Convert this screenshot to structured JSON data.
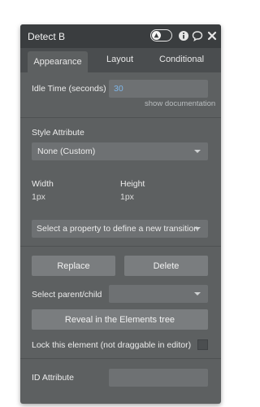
{
  "window": {
    "title": "Detect B",
    "icons": [
      "toggle-icon",
      "info-icon",
      "comment-icon",
      "close-icon"
    ]
  },
  "tabs": [
    {
      "label": "Appearance",
      "active": true
    },
    {
      "label": "Layout",
      "active": false
    },
    {
      "label": "Conditional",
      "active": false
    }
  ],
  "idle_time": {
    "label": "Idle Time (seconds)",
    "value": "30",
    "help_link": "show documentation"
  },
  "style_attribute": {
    "label": "Style Attribute",
    "value": "None (Custom)"
  },
  "dimensions": {
    "width_label": "Width",
    "width_value": "1px",
    "height_label": "Height",
    "height_value": "1px"
  },
  "transition": {
    "placeholder": "Select a property to define a new transition"
  },
  "actions": {
    "replace_label": "Replace",
    "delete_label": "Delete"
  },
  "parent_child": {
    "label": "Select parent/child",
    "value": ""
  },
  "reveal": {
    "label": "Reveal in the Elements tree"
  },
  "lock": {
    "label": "Lock this element (not draggable in editor)",
    "checked": false
  },
  "id_attribute": {
    "label": "ID Attribute",
    "value": ""
  },
  "colors": {
    "panel": "#5d6061",
    "titlebar": "#3a3d3f",
    "link_value": "#7fb6e8"
  }
}
